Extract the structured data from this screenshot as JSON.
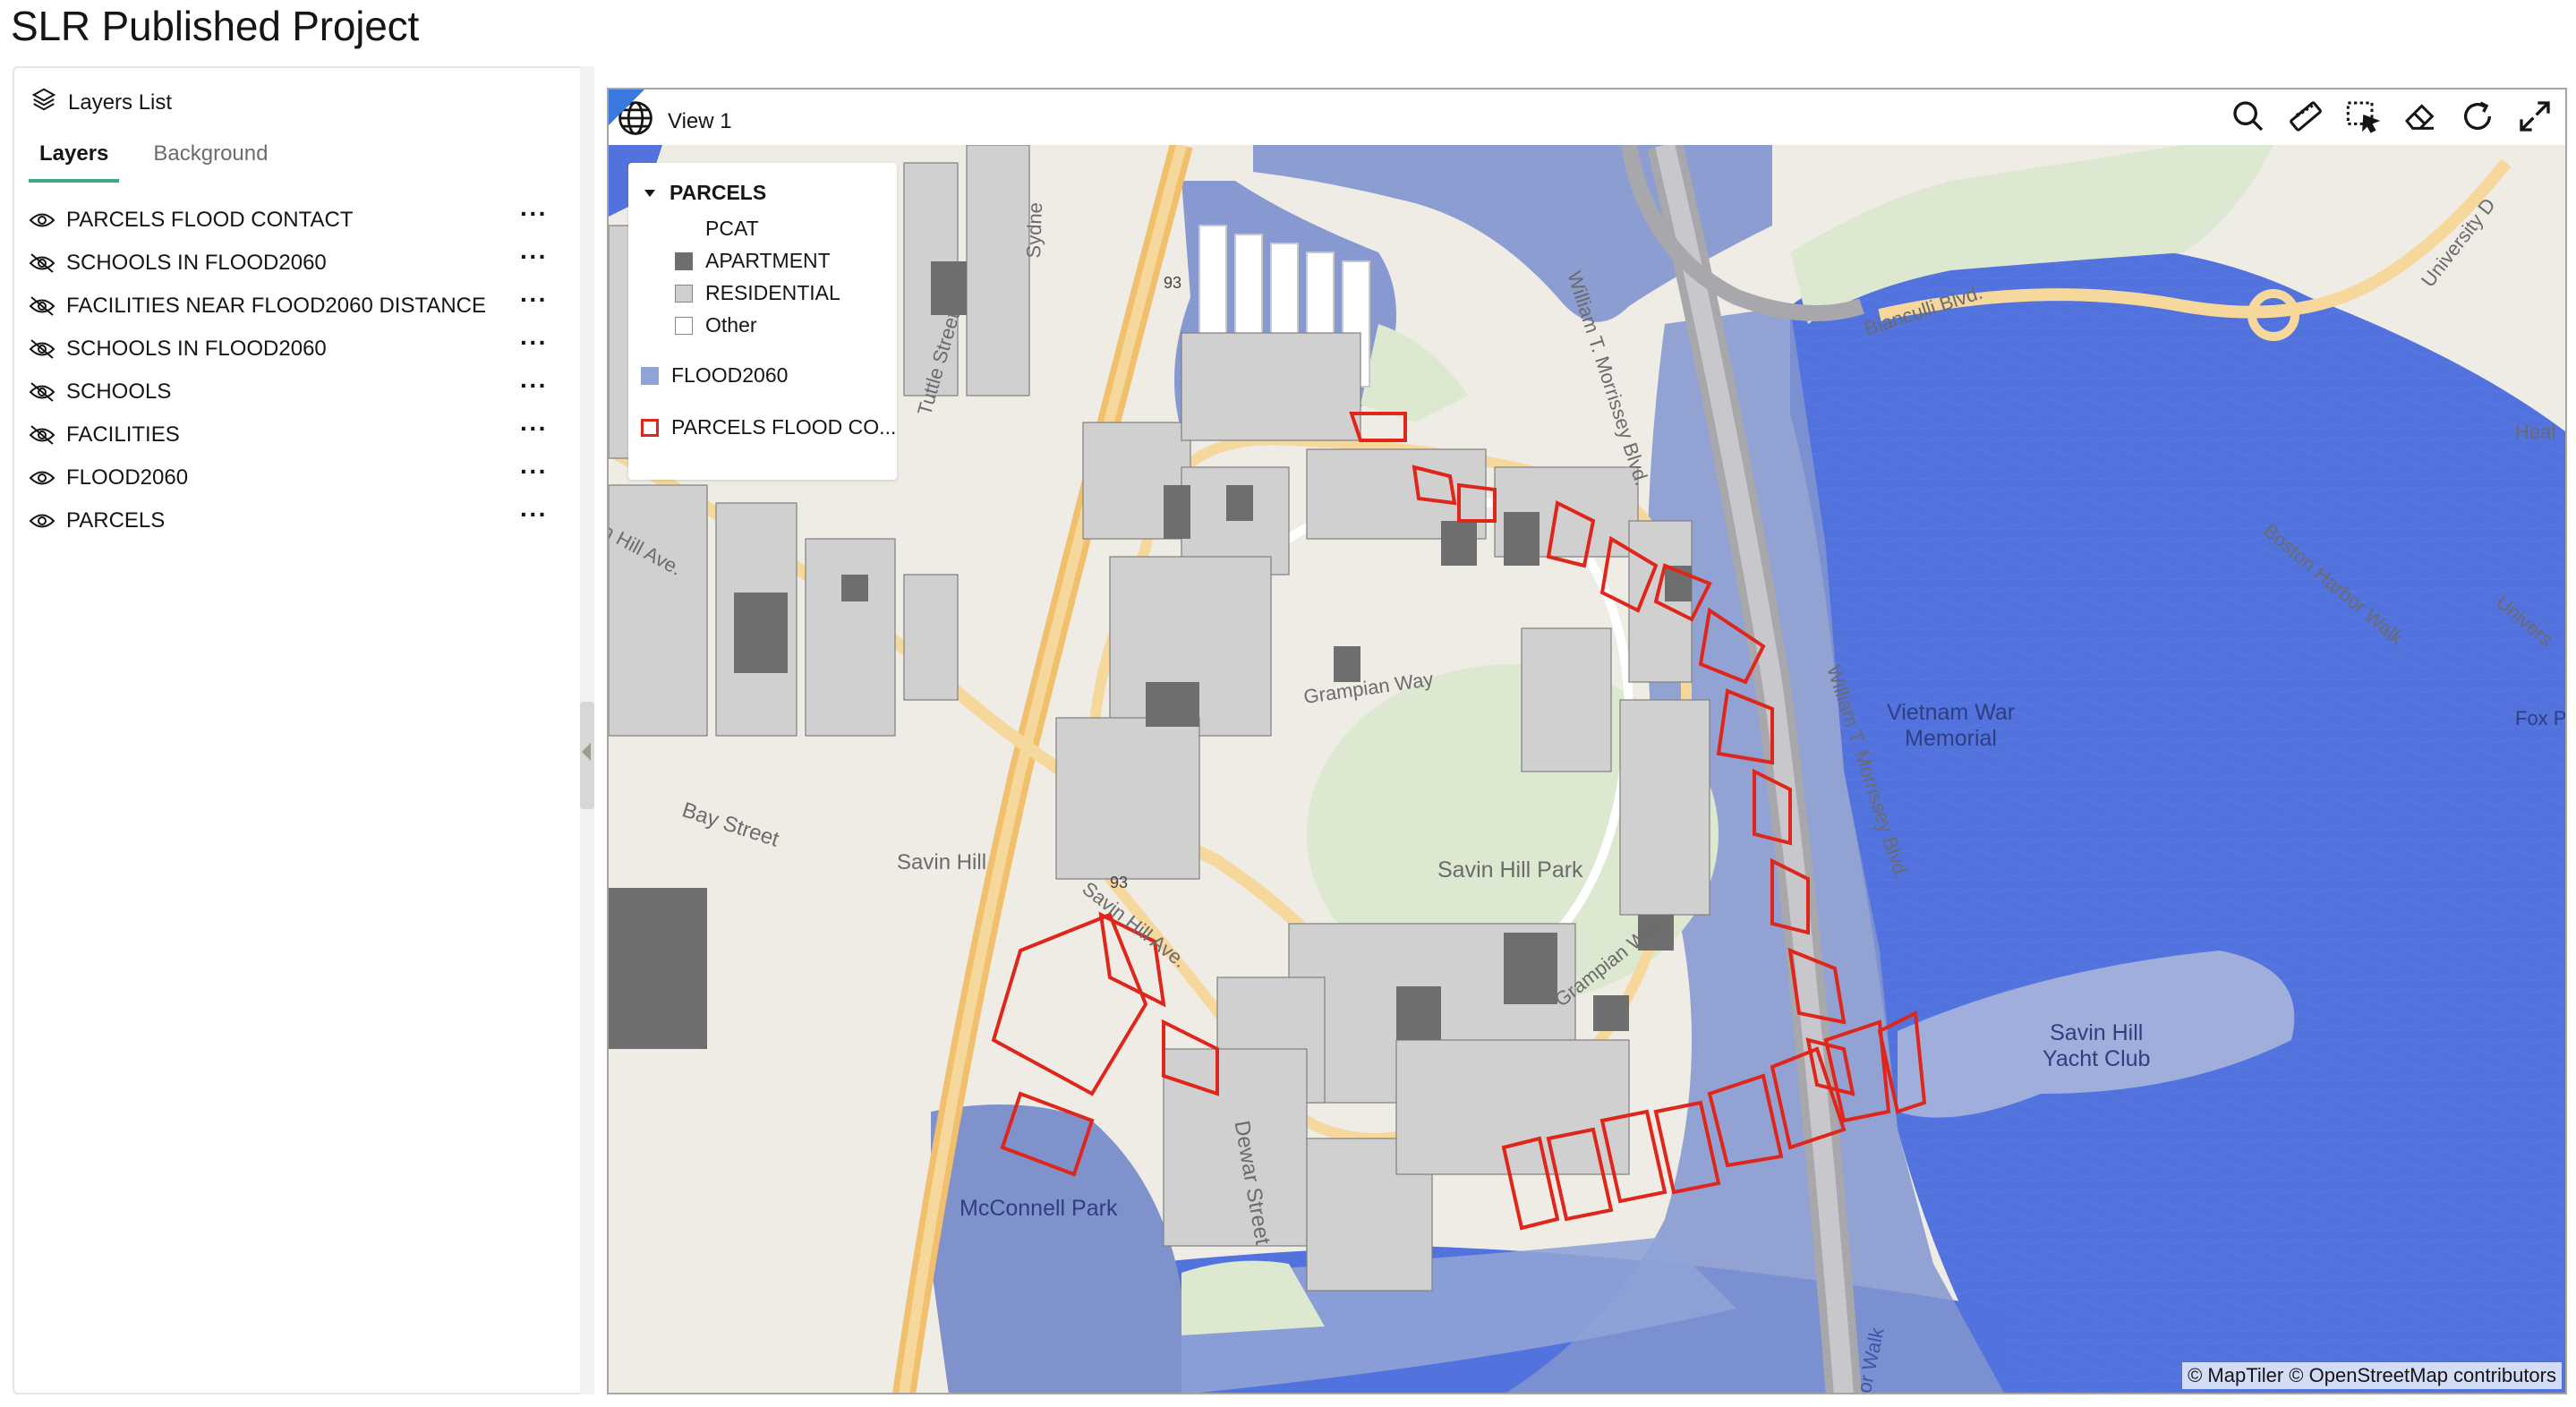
{
  "page": {
    "title": "SLR Published Project"
  },
  "layers_panel": {
    "header": "Layers List",
    "tabs": [
      {
        "label": "Layers",
        "active": true
      },
      {
        "label": "Background",
        "active": false
      }
    ],
    "layers": [
      {
        "name": "PARCELS FLOOD CONTACT",
        "visible": true,
        "icon": "eye-icon"
      },
      {
        "name": "SCHOOLS IN FLOOD2060",
        "visible": false,
        "icon": "eye-off-icon"
      },
      {
        "name": "FACILITIES NEAR FLOOD2060 DISTANCE",
        "visible": false,
        "icon": "eye-off-icon"
      },
      {
        "name": "SCHOOLS IN FLOOD2060",
        "visible": false,
        "icon": "eye-off-icon"
      },
      {
        "name": "SCHOOLS",
        "visible": false,
        "icon": "eye-off-icon"
      },
      {
        "name": "FACILITIES",
        "visible": false,
        "icon": "eye-off-icon"
      },
      {
        "name": "FLOOD2060",
        "visible": true,
        "icon": "eye-icon"
      },
      {
        "name": "PARCELS",
        "visible": true,
        "icon": "eye-icon"
      }
    ],
    "more_label": "···"
  },
  "view": {
    "title": "View 1",
    "tools": [
      "search-icon",
      "ruler-icon",
      "select-area-icon",
      "eraser-icon",
      "refresh-icon",
      "fullscreen-icon"
    ]
  },
  "legend": {
    "group_title": "PARCELS",
    "field": "PCAT",
    "items": [
      {
        "label": "APARTMENT",
        "color": "#6e6e6e"
      },
      {
        "label": "RESIDENTIAL",
        "color": "#d0d0d0"
      },
      {
        "label": "Other",
        "color": "#ffffff"
      }
    ],
    "flood_label": "FLOOD2060",
    "flood_color": "#8fa3d6",
    "contact_label": "PARCELS FLOOD CO...",
    "contact_color": "#e0251b"
  },
  "map": {
    "labels": {
      "savin_hill_park": "Savin Hill Park",
      "vietnam_memorial": "Vietnam War\nMemorial",
      "yacht_club": "Savin Hill\nYacht Club",
      "mcconnell_park": "McConnell Park",
      "savin_hill": "Savin Hill",
      "bay_street": "Bay Street",
      "dewar_street": "Dewar Street",
      "tuttle_street": "Tuttle Street",
      "grampian_way": "Grampian Way",
      "savin_hill_ave": "Savin Hill Ave.",
      "hill_ave": "n Hill Ave.",
      "morrissey_blvd": "William T. Morrissey Blvd.",
      "bianculli_blvd": "Bianculli Blvd.",
      "boston_harbor_walk": "Boston Harbor Walk",
      "harbor_walk": "Harbor Walk",
      "university_dr": "University D",
      "universe": "Univers",
      "heal": "Heal",
      "fox_p": "Fox P",
      "sydne": "Sydne",
      "route_93": "93"
    },
    "attribution": "© MapTiler  © OpenStreetMap contributors"
  }
}
